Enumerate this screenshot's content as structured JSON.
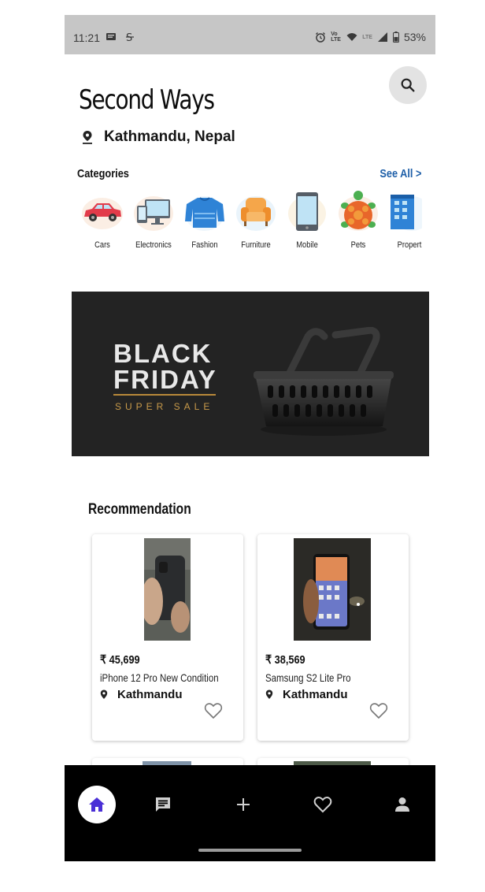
{
  "status_bar": {
    "time": "11:21",
    "battery": "53%",
    "volte": "Vo LTE",
    "lte": "LTE"
  },
  "header": {
    "title": "Second Ways",
    "location": "Kathmandu, Nepal"
  },
  "categories": {
    "title": "Categories",
    "see_all": "See All",
    "items": [
      {
        "label": "Cars",
        "icon": "car-icon"
      },
      {
        "label": "Electronics",
        "icon": "computer-icon"
      },
      {
        "label": "Fashion",
        "icon": "sweater-icon"
      },
      {
        "label": "Furniture",
        "icon": "armchair-icon"
      },
      {
        "label": "Mobile",
        "icon": "smartphone-icon"
      },
      {
        "label": "Pets",
        "icon": "turtle-icon"
      },
      {
        "label": "Propert",
        "icon": "building-icon"
      }
    ]
  },
  "banner": {
    "line1": "BLACK",
    "line2": "FRIDAY",
    "subtitle": "SUPER SALE"
  },
  "recommendation": {
    "title": "Recommendation",
    "products": [
      {
        "price": "₹ 45,699",
        "name": "iPhone 12 Pro New Condition",
        "location": "Kathmandu"
      },
      {
        "price": "₹ 38,569",
        "name": "Samsung S2 Lite Pro",
        "location": "Kathmandu"
      }
    ]
  },
  "bottom_nav": [
    "home",
    "messages",
    "add",
    "favorites",
    "profile"
  ],
  "colors": {
    "accent": "#4a2fd6",
    "link": "#1e5fa8",
    "banner_gold": "#c89a4a"
  }
}
